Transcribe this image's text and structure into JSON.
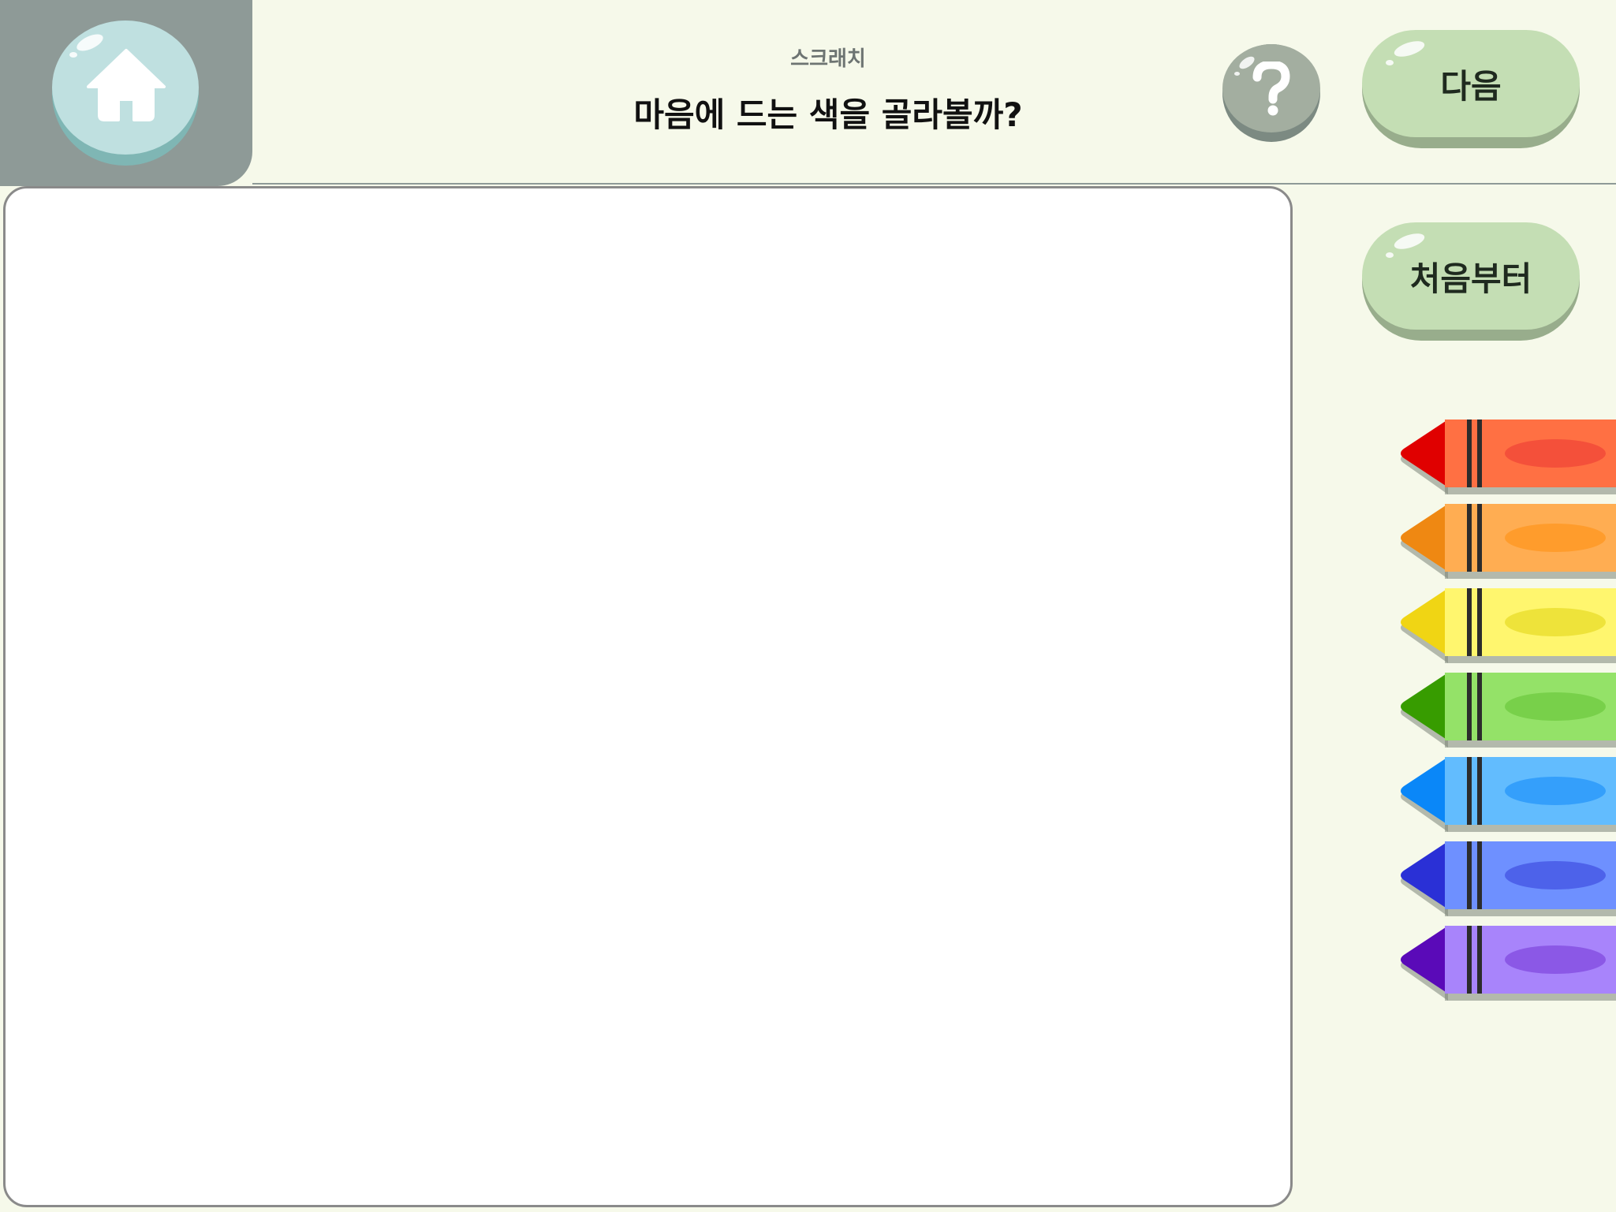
{
  "header": {
    "app_name": "스크래치",
    "title": "마음에 드는 색을 골라볼까?"
  },
  "icons": {
    "home": "home-icon",
    "help": "question-icon"
  },
  "buttons": {
    "next_label": "다음",
    "restart_label": "처음부터"
  },
  "crayons": [
    {
      "name": "red",
      "tip": "#e00000",
      "body": "#ff7043",
      "oval": "#f4503a"
    },
    {
      "name": "orange",
      "tip": "#ef8812",
      "body": "#ffad52",
      "oval": "#ff9c2c"
    },
    {
      "name": "yellow",
      "tip": "#f0d514",
      "body": "#fff66e",
      "oval": "#eee33a"
    },
    {
      "name": "green",
      "tip": "#379c00",
      "body": "#94e268",
      "oval": "#78d04a"
    },
    {
      "name": "sky-blue",
      "tip": "#0a87f8",
      "body": "#62bcfe",
      "oval": "#349ffb"
    },
    {
      "name": "blue",
      "tip": "#2a30d6",
      "body": "#6e90ff",
      "oval": "#4d62ea"
    },
    {
      "name": "purple",
      "tip": "#5a0ab8",
      "body": "#a884fb",
      "oval": "#8b58e6"
    }
  ]
}
